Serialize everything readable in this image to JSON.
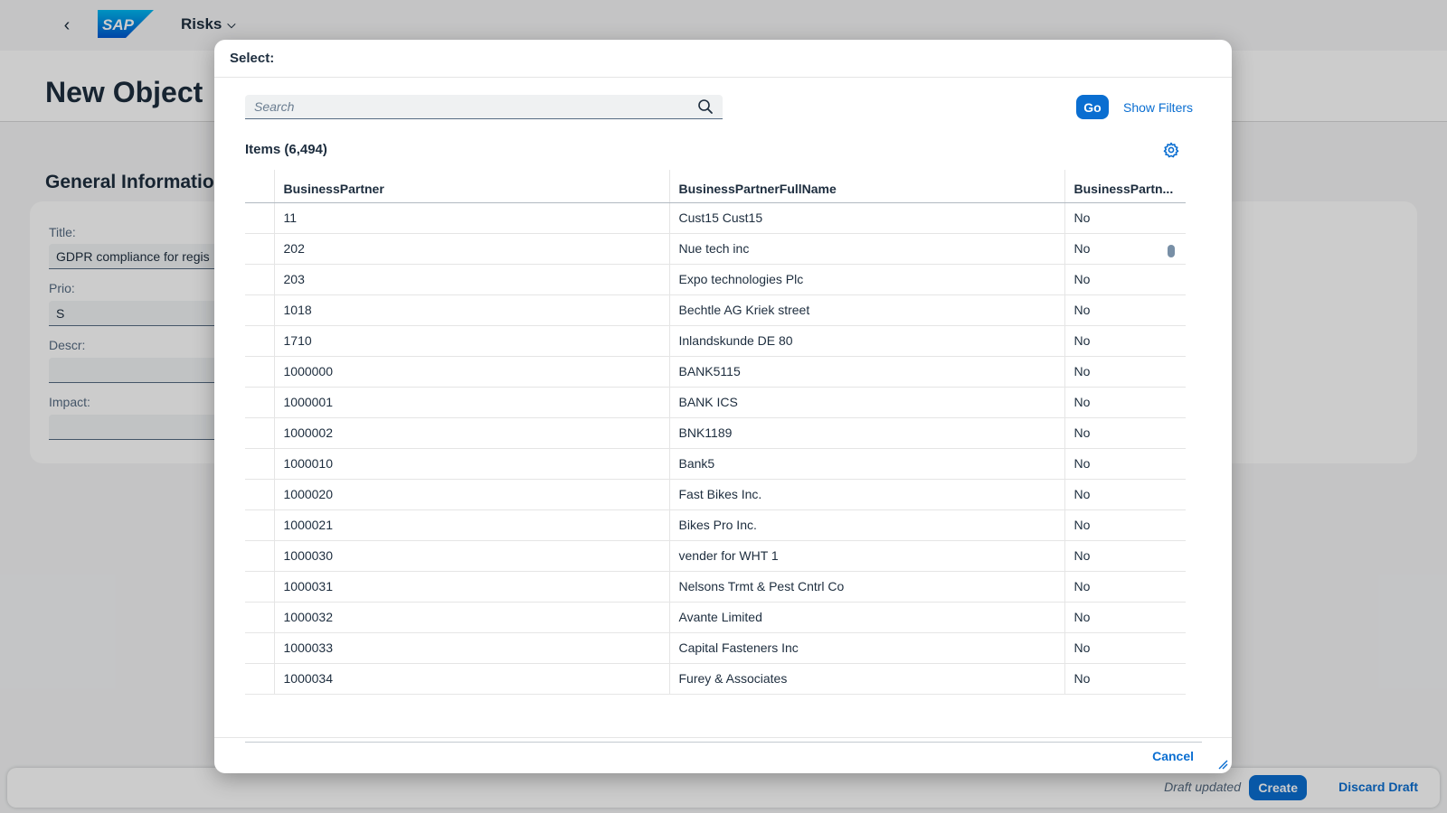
{
  "shell": {
    "logo_text": "SAP",
    "app_title": "Risks"
  },
  "page": {
    "object_title": "New Object",
    "section_title": "General Information",
    "fields": {
      "title_label": "Title:",
      "title_value": "GDPR compliance for regis",
      "prio_label": "Prio:",
      "prio_value": "S",
      "descr_label": "Descr:",
      "descr_value": "",
      "impact_label": "Impact:",
      "impact_value": ""
    }
  },
  "footer": {
    "status": "Draft updated",
    "create_label": "Create",
    "discard_label": "Discard Draft"
  },
  "dialog": {
    "title": "Select:",
    "search_placeholder": "Search",
    "go_label": "Go",
    "show_filters_label": "Show Filters",
    "items_title": "Items (6,494)",
    "columns": [
      "BusinessPartner",
      "BusinessPartnerFullName",
      "BusinessPartn..."
    ],
    "rows": [
      [
        "11",
        "Cust15 Cust15",
        "No"
      ],
      [
        "202",
        "Nue tech inc",
        "No"
      ],
      [
        "203",
        "Expo technologies Plc",
        "No"
      ],
      [
        "1018",
        "Bechtle AG Kriek street",
        "No"
      ],
      [
        "1710",
        "Inlandskunde DE 80",
        "No"
      ],
      [
        "1000000",
        "BANK5115",
        "No"
      ],
      [
        "1000001",
        "BANK ICS",
        "No"
      ],
      [
        "1000002",
        "BNK1189",
        "No"
      ],
      [
        "1000010",
        "Bank5",
        "No"
      ],
      [
        "1000020",
        "Fast Bikes Inc.",
        "No"
      ],
      [
        "1000021",
        "Bikes Pro Inc.",
        "No"
      ],
      [
        "1000030",
        "vender for WHT 1",
        "No"
      ],
      [
        "1000031",
        "Nelsons Trmt & Pest Cntrl Co",
        "No"
      ],
      [
        "1000032",
        "Avante Limited",
        "No"
      ],
      [
        "1000033",
        "Capital Fasteners Inc",
        "No"
      ],
      [
        "1000034",
        "Furey & Associates",
        "No"
      ]
    ],
    "cancel_label": "Cancel"
  },
  "icons": {
    "back": "chevron-left-icon",
    "app_menu": "chevron-down-icon",
    "search": "search-icon",
    "settings": "gear-icon",
    "resize": "resize-handle-icon"
  },
  "colors": {
    "accent": "#0a6ed1",
    "logo_blue": "#0070f2",
    "text": "#1d2d3e"
  }
}
